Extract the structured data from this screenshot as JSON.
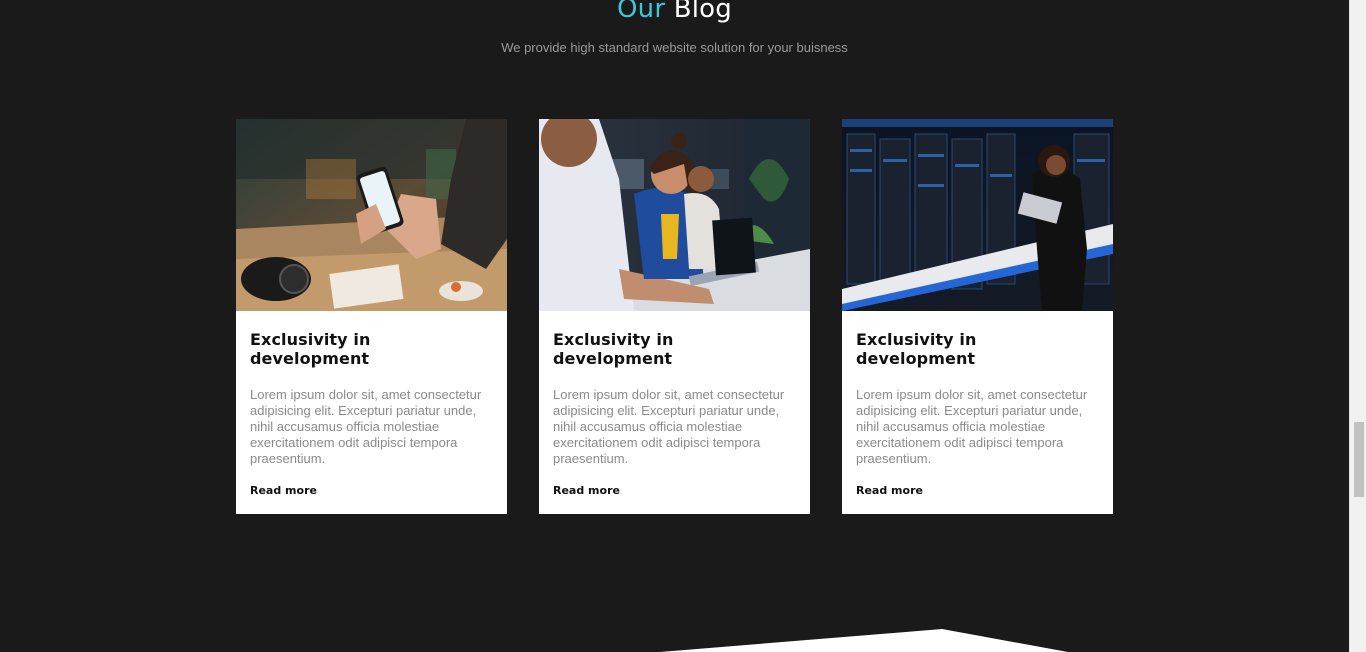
{
  "section": {
    "title_accent": "Our",
    "title_rest": "Blog",
    "subtitle": "We provide high standard website solution for your buisness"
  },
  "colors": {
    "background": "#1a1a1a",
    "accent": "#3ec6d2",
    "card": "#ffffff"
  },
  "cards": [
    {
      "image": "person-holding-phone-photo",
      "title": "Exclusivity in development",
      "text": "Lorem ipsum dolor sit, amet consectetur adipisicing elit. Excepturi pariatur unde, nihil accusamus officia molestiae exercitationem odit adipisci tempora praesentium.",
      "link": "Read more"
    },
    {
      "image": "office-team-smiling-photo",
      "title": "Exclusivity in development",
      "text": "Lorem ipsum dolor sit, amet consectetur adipisicing elit. Excepturi pariatur unde, nihil accusamus officia molestiae exercitationem odit adipisci tempora praesentium.",
      "link": "Read more"
    },
    {
      "image": "server-room-woman-laptop-photo",
      "title": "Exclusivity in development",
      "text": "Lorem ipsum dolor sit, amet consectetur adipisicing elit. Excepturi pariatur unde, nihil accusamus officia molestiae exercitationem odit adipisci tempora praesentium.",
      "link": "Read more"
    }
  ]
}
